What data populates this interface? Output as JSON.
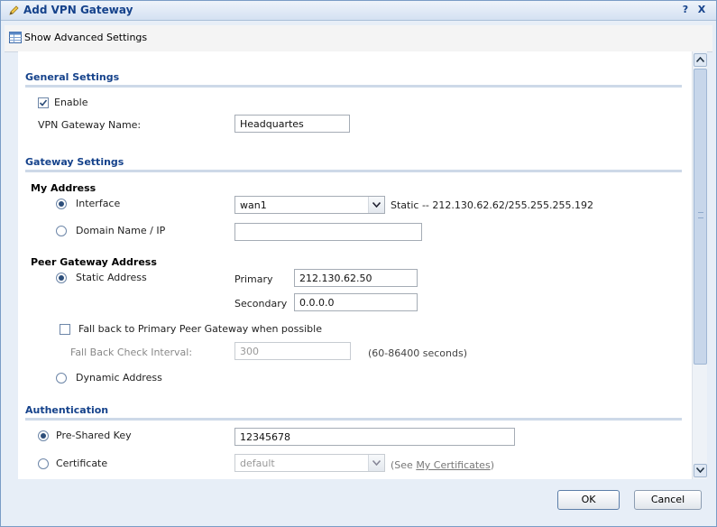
{
  "window": {
    "title": "Add VPN Gateway",
    "help_label": "?",
    "close_label": "X"
  },
  "toolbar": {
    "advanced_label": "Show Advanced Settings"
  },
  "general": {
    "heading": "General Settings",
    "enable_label": "Enable",
    "enable_checked": true,
    "name_label": "VPN Gateway Name:",
    "name_value": "Headquartes"
  },
  "gateway": {
    "heading": "Gateway Settings",
    "my_address_heading": "My Address",
    "interface_label": "Interface",
    "interface_selected": true,
    "interface_value": "wan1",
    "interface_status": "Static -- 212.130.62.62/255.255.255.192",
    "domain_label": "Domain Name / IP",
    "domain_selected": false,
    "domain_value": "",
    "peer_heading": "Peer Gateway Address",
    "static_label": "Static Address",
    "static_selected": true,
    "primary_label": "Primary",
    "primary_value": "212.130.62.50",
    "secondary_label": "Secondary",
    "secondary_value": "0.0.0.0",
    "fallback_label": "Fall back to Primary Peer Gateway when possible",
    "fallback_checked": false,
    "interval_label": "Fall Back Check Interval:",
    "interval_value": "300",
    "interval_hint": "(60-86400 seconds)",
    "dynamic_label": "Dynamic Address",
    "dynamic_selected": false
  },
  "auth": {
    "heading": "Authentication",
    "psk_label": "Pre-Shared Key",
    "psk_selected": true,
    "psk_value": "12345678",
    "cert_label": "Certificate",
    "cert_selected": false,
    "cert_value": "default",
    "see_prefix": "(See ",
    "see_link": "My Certificates",
    "see_suffix": ")"
  },
  "footer": {
    "ok_label": "OK",
    "cancel_label": "Cancel"
  },
  "colors": {
    "title_text": "#15428b",
    "frame_bg": "#e7eef7",
    "section_line": "#cdd9e8"
  }
}
